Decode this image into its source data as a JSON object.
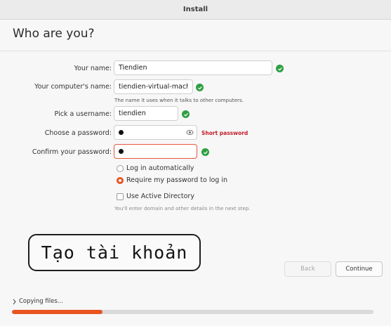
{
  "window": {
    "title": "Install"
  },
  "page": {
    "title": "Who are you?"
  },
  "form": {
    "name": {
      "label": "Your name:",
      "value": "Tiendien"
    },
    "computer": {
      "label": "Your computer's name:",
      "value": "tiendien-virtual-machir",
      "hint": "The name it uses when it talks to other computers."
    },
    "username": {
      "label": "Pick a username:",
      "value": "tiendien"
    },
    "password": {
      "label": "Choose a password:",
      "strength": "Short password"
    },
    "confirm": {
      "label": "Confirm your password:"
    },
    "login_options": [
      {
        "label": "Log in automatically",
        "selected": false
      },
      {
        "label": "Require my password to log in",
        "selected": true
      }
    ],
    "active_directory": {
      "label": "Use Active Directory",
      "checked": false,
      "hint": "You'll enter domain and other details in the next step."
    }
  },
  "annotation": {
    "text": "Tạo tài khoản"
  },
  "buttons": {
    "back": "Back",
    "continue": "Continue"
  },
  "status": {
    "text": "Copying files...",
    "progress": 0.25
  },
  "colors": {
    "accent": "#e95420",
    "ok": "#2ea043",
    "error": "#c01c28"
  },
  "icons": [
    "check-circle-icon",
    "eye-icon",
    "chevron-right-icon"
  ]
}
